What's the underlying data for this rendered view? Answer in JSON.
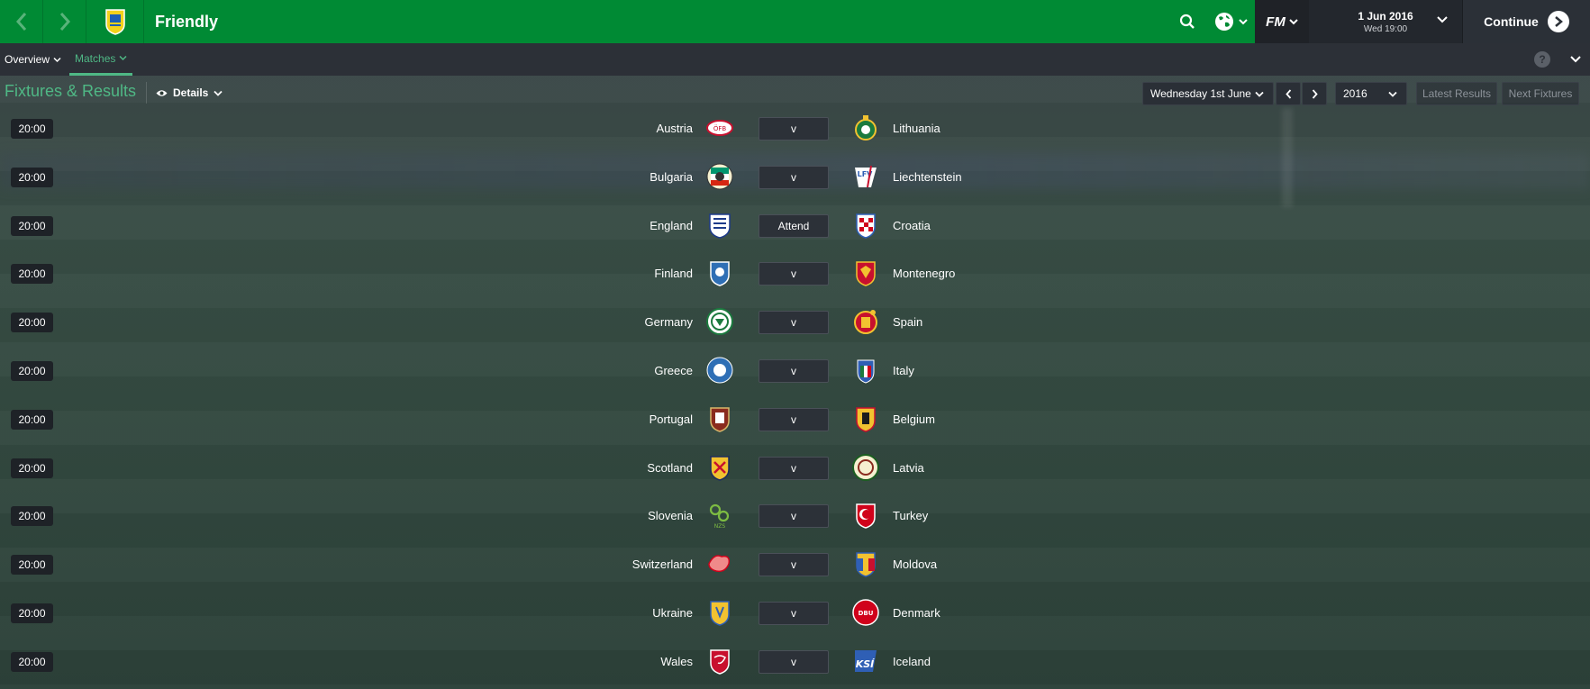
{
  "topbar": {
    "title": "Friendly",
    "date": "1 Jun 2016",
    "time": "Wed 19:00",
    "fm_label": "FM",
    "continue_label": "Continue"
  },
  "subnav": {
    "tabs": [
      {
        "label": "Overview"
      },
      {
        "label": "Matches"
      }
    ],
    "help": "?"
  },
  "page": {
    "title": "Fixtures & Results",
    "details_label": "Details",
    "date_select": "Wednesday 1st June",
    "year_select": "2016",
    "latest_results": "Latest Results",
    "next_fixtures": "Next Fixtures"
  },
  "fixtures": [
    {
      "time": "20:00",
      "home": "Austria",
      "result": "v",
      "away": "Lithuania"
    },
    {
      "time": "20:00",
      "home": "Bulgaria",
      "result": "v",
      "away": "Liechtenstein"
    },
    {
      "time": "20:00",
      "home": "England",
      "result": "Attend",
      "away": "Croatia"
    },
    {
      "time": "20:00",
      "home": "Finland",
      "result": "v",
      "away": "Montenegro"
    },
    {
      "time": "20:00",
      "home": "Germany",
      "result": "v",
      "away": "Spain"
    },
    {
      "time": "20:00",
      "home": "Greece",
      "result": "v",
      "away": "Italy"
    },
    {
      "time": "20:00",
      "home": "Portugal",
      "result": "v",
      "away": "Belgium"
    },
    {
      "time": "20:00",
      "home": "Scotland",
      "result": "v",
      "away": "Latvia"
    },
    {
      "time": "20:00",
      "home": "Slovenia",
      "result": "v",
      "away": "Turkey"
    },
    {
      "time": "20:00",
      "home": "Switzerland",
      "result": "v",
      "away": "Moldova"
    },
    {
      "time": "20:00",
      "home": "Ukraine",
      "result": "v",
      "away": "Denmark"
    },
    {
      "time": "20:00",
      "home": "Wales",
      "result": "v",
      "away": "Iceland"
    }
  ],
  "colors": {
    "topbar": "#008a34",
    "accent": "#4fb885"
  }
}
